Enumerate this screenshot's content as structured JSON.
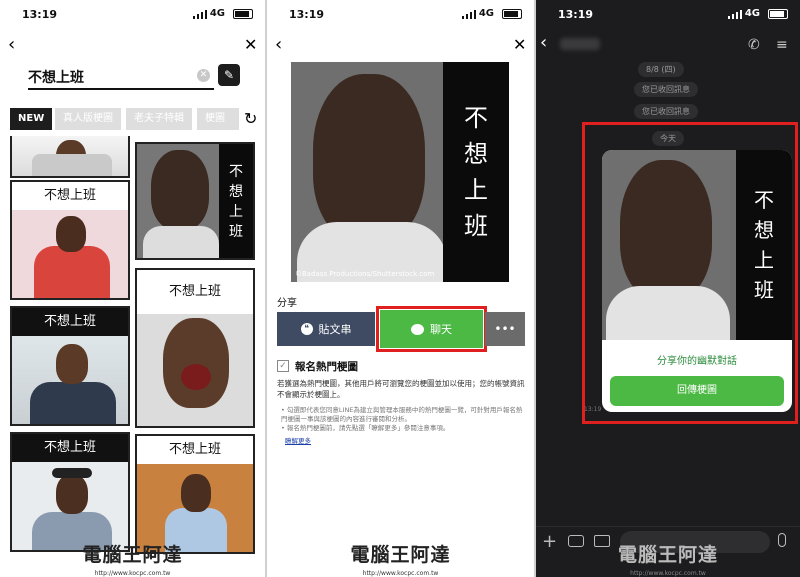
{
  "status": {
    "time": "13:19",
    "network": "4G"
  },
  "panel1": {
    "search_value": "不想上班",
    "tabs": [
      "NEW",
      "真人版梗圖",
      "老夫子特輯",
      "梗圖大"
    ],
    "memes": [
      {
        "caption": "不想上班"
      },
      {
        "caption": "不想上班"
      },
      {
        "caption": "不想上班"
      },
      {
        "caption": "不想上班"
      },
      {
        "caption": "不想上班"
      }
    ],
    "tall_meme_text": [
      "不",
      "想",
      "上",
      "班"
    ]
  },
  "panel2": {
    "meme_text": [
      "不",
      "想",
      "上",
      "班"
    ],
    "image_credit": "©Badass Productions/Shutterstock.com",
    "share_label": "分享",
    "post_button": "貼文串",
    "chat_button": "聊天",
    "more_button": "•••",
    "checkbox_label": "報名熱門梗圖",
    "description": "若獲選為熱門梗圖，其他用戶將可瀏覽您的梗圖並加以使用；您的帳號資訊不會顯示於梗圖上。",
    "notes": [
      "• 勾選即代表您同意LINE為建立與管理本服務中的熱門梗圖一覽，可針對用戶報名熱門梗圖一事與該梗圖的內容進行審閱和分析。",
      "• 報名熱門梗圖前，請先點選「瞭解更多」參閱注意事項。"
    ],
    "learn_more": "瞭解更多"
  },
  "panel3": {
    "date_badge": "8/8 (四)",
    "recall_1": "您已收回訊息",
    "recall_2": "您已收回訊息",
    "today": "今天",
    "meme_text": [
      "不",
      "想",
      "上",
      "班"
    ],
    "card_title": "分享你的幽默對話",
    "card_button": "回傳梗圖",
    "msg_time": "13:19"
  },
  "watermark": {
    "text": "電腦王阿達",
    "url": "http://www.kocpc.com.tw"
  },
  "colors": {
    "green": "#4cb944",
    "red": "#e0201f",
    "navy": "#3f4b63",
    "gray_btn": "#6b6b6b"
  }
}
